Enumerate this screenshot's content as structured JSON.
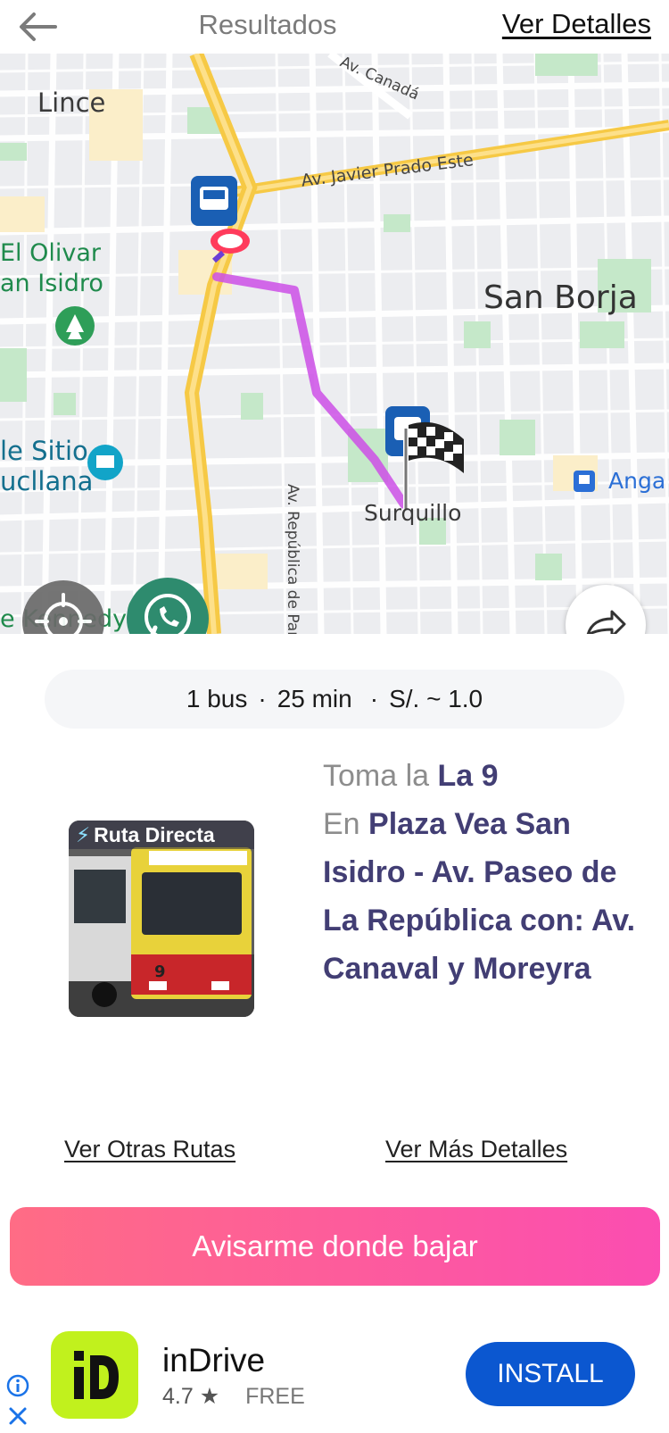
{
  "header": {
    "title": "Resultados",
    "details_link": "Ver Detalles",
    "back_icon": "arrow-left-icon"
  },
  "map": {
    "labels": {
      "lince": "Lince",
      "olivar_1": "El Olivar",
      "olivar_2": "an Isidro",
      "sitio_1": "le Sitio",
      "sitio_2": "ucllana",
      "kennedy": "e Kennedy",
      "san_borja": "San Borja",
      "surquillo": "Surquillo",
      "angamos": "Anga",
      "canada": "Av. Canadá",
      "javier_prado": "Av. Javier Prado Este",
      "republica": "Av. República de Pan"
    },
    "colors": {
      "route": "#d45cf0",
      "highway": "#f6c945",
      "park": "#c5e8c9",
      "marker": "#1a5fb4"
    },
    "buttons": {
      "locate_icon": "crosshair-icon",
      "whatsapp_icon": "whatsapp-icon",
      "share_icon": "share-arrow-icon"
    }
  },
  "summary": {
    "buses": "1 bus",
    "duration": "25 min",
    "fare": "S/. ~ 1.0",
    "separator": "·"
  },
  "route": {
    "image_badge": "Ruta Directa",
    "take_prefix": "Toma la",
    "line": "La 9",
    "at_prefix": "En",
    "stop": "Plaza Vea San Isidro - Av. Paseo de La República con: Av. Canaval y Moreyra"
  },
  "links": {
    "other_routes": "Ver Otras Rutas",
    "more_details": "Ver Más Detalles"
  },
  "cta": {
    "label": "Avisarme donde bajar",
    "color_start": "#ff6c85",
    "color_end": "#fb4db1"
  },
  "ad": {
    "app_name": "inDrive",
    "rating": "4.7",
    "star": "★",
    "price": "FREE",
    "install_label": "INSTALL",
    "brand_color": "#c1f11d",
    "button_color": "#0b57d0"
  }
}
